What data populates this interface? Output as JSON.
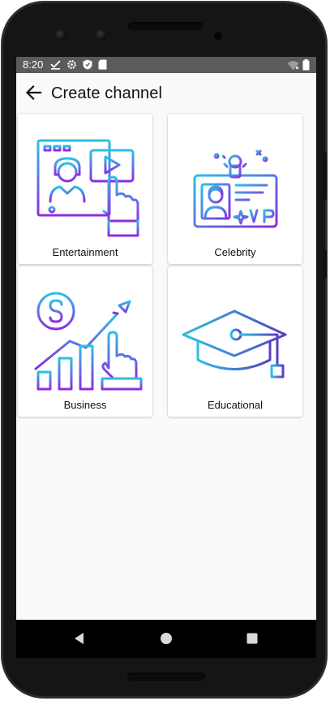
{
  "status_bar": {
    "time": "8:20",
    "left_icons": [
      "download-done-icon",
      "settings-icon",
      "shield-icon",
      "sd-card-icon"
    ],
    "right_icons": [
      "wifi-icon",
      "battery-icon"
    ]
  },
  "app_bar": {
    "back_icon": "arrow-left-icon",
    "title": "Create channel"
  },
  "categories": [
    {
      "label": "Entertainment",
      "icon": "entertainment-icon"
    },
    {
      "label": "Celebrity",
      "icon": "celebrity-vip-icon"
    },
    {
      "label": "Business",
      "icon": "business-growth-icon"
    },
    {
      "label": "Educational",
      "icon": "graduation-cap-icon"
    }
  ],
  "nav_bar": {
    "back": "nav-back-icon",
    "home": "nav-home-icon",
    "recents": "nav-recents-icon"
  },
  "colors": {
    "gradient_start": "#2bc0e4",
    "gradient_end": "#8e2de2",
    "status_bar": "#5b5b5b",
    "background": "#fafafa"
  }
}
